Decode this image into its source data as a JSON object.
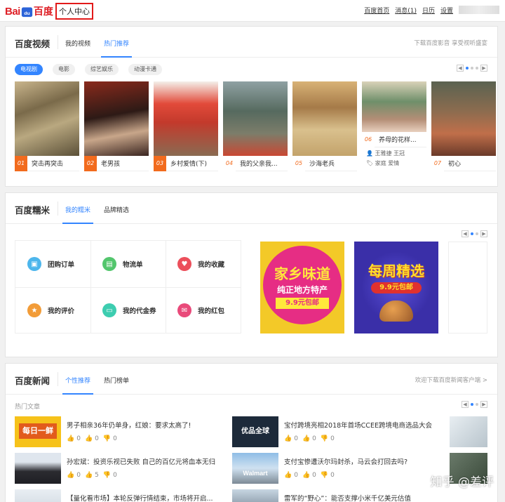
{
  "topbar": {
    "logo_left": "Bai",
    "logo_right": "百度",
    "center_label": "个人中心",
    "nav": [
      "百度首页",
      "消息(1)",
      "日历",
      "设置"
    ]
  },
  "video": {
    "title": "百度视频",
    "tabs": [
      "我的视频",
      "热门推荐"
    ],
    "right_links": "下载百度影音  享受视听盛宴",
    "pills": [
      "电视剧",
      "电影",
      "综艺娱乐",
      "动漫卡通"
    ],
    "items": [
      {
        "num": "01",
        "title": "突击再突击"
      },
      {
        "num": "02",
        "title": "老男孩"
      },
      {
        "num": "03",
        "title": "乡村爱情(下)"
      },
      {
        "num": "04",
        "title": "我的父亲我..."
      },
      {
        "num": "05",
        "title": "沙海老兵"
      },
      {
        "num": "06",
        "title": "养母的花样...",
        "actors": "王雅捷  王冠",
        "tags": "家庭  爱情"
      },
      {
        "num": "07",
        "title": "初心"
      }
    ]
  },
  "nuomi": {
    "title": "百度糯米",
    "tabs": [
      "我的糯米",
      "品牌精选"
    ],
    "cells": [
      {
        "label": "团购订单",
        "color": "#4db6ec",
        "icon": "cart-icon"
      },
      {
        "label": "物流单",
        "color": "#53c66d",
        "icon": "truck-icon"
      },
      {
        "label": "我的收藏",
        "color": "#ec4f5b",
        "icon": "heart-icon"
      },
      {
        "label": "我的评价",
        "color": "#f29c38",
        "icon": "comment-icon"
      },
      {
        "label": "我的代金券",
        "color": "#3dcdb0",
        "icon": "voucher-icon"
      },
      {
        "label": "我的红包",
        "color": "#e94a7a",
        "icon": "redpacket-icon"
      }
    ],
    "promo1": {
      "line1": "家乡味道",
      "line2": "纯正地方特产",
      "price": "9.9元包邮"
    },
    "promo2": {
      "line1": "每周精选",
      "price": "9.9元包邮"
    }
  },
  "news": {
    "title": "百度新闻",
    "tabs": [
      "个性推荐",
      "热门榜单"
    ],
    "right_link": "欢迎下载百度新闻客户端 >",
    "subtitle": "热门文章",
    "items": [
      {
        "title": "男子相亲36年仍单身，红娘：要求太高了!",
        "c1": "0",
        "c2": "0",
        "c3": "0",
        "thumb_text": "每日一鲜"
      },
      {
        "title": "宝付跨境亮相2018年首场CCEE跨境电商选品大会",
        "c1": "0",
        "c2": "0",
        "c3": "0",
        "thumb_text": "优品全球"
      },
      {
        "title": "孙宏斌：投资乐视已失败 自己的百亿元将血本无归",
        "c1": "0",
        "c2": "5",
        "c3": "0",
        "thumb_text": ""
      },
      {
        "title": "支付宝惨遭沃尔玛封杀，马云会打回去吗?",
        "c1": "0",
        "c2": "0",
        "c3": "0",
        "thumb_text": "Walmart"
      },
      {
        "title": "【量化看市场】本轮反弹行情结束，市场将开启...",
        "thumb_text": ""
      },
      {
        "title": "雷军的“野心”：能否支撑小米千亿美元估值",
        "thumb_text": ""
      }
    ]
  },
  "watermark": "知乎 @差评"
}
